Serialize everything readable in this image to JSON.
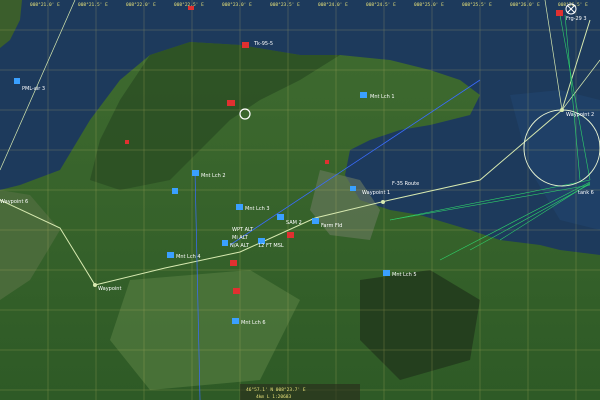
{
  "grid": {
    "top_coords": [
      "008°21.0' E",
      "008°21.5' E",
      "008°22.0' E",
      "008°22.5' E",
      "008°23.0' E",
      "008°23.5' E",
      "008°24.0' E",
      "008°24.5' E",
      "008°25.0' E",
      "008°25.5' E",
      "008°26.0' E",
      "008°26.5' E",
      "008°27.0' E"
    ]
  },
  "waypoints": {
    "wp_left": "Waypoint",
    "wp1": "Waypoint 1",
    "wp2": "Waypoint 2",
    "wp3": "Waypoint 3",
    "wp4": "Waypoint",
    "wp6": "Waypoint 6"
  },
  "labels": {
    "pml_air": "PML-air 3",
    "tk": "Tk-95-5",
    "fnd_top": "Frg-29 3",
    "mnt1": "Mnt Lch 1",
    "mnt2": "Mnt Lch 2",
    "mnt3": "Mnt Lch 3",
    "mnt4": "Mnt Lch 4",
    "mnt5": "Mnt Lch 5",
    "mnt6": "Mnt Lch 6",
    "mnt7": "Mnt Lch 7",
    "f35": "F-35 Route",
    "tank": "tank 6",
    "alt1": "WPT ALT",
    "alt2": "Mi ALT",
    "alt3": "N/A ALT",
    "msl": "12 FT MSL",
    "flight": "Farm Fld",
    "sam": "SAM 2",
    "bottom_line1": "46°57.1' N  008°23.7' E",
    "bottom_line2": "4km  L   1:20683"
  },
  "colors": {
    "water": "#1d3a5c",
    "grid": "#c9c26a",
    "route": "#d7e9b0",
    "blue_marker": "#3aa0ff",
    "red_marker": "#e03030",
    "green_line": "#2ed36b"
  }
}
